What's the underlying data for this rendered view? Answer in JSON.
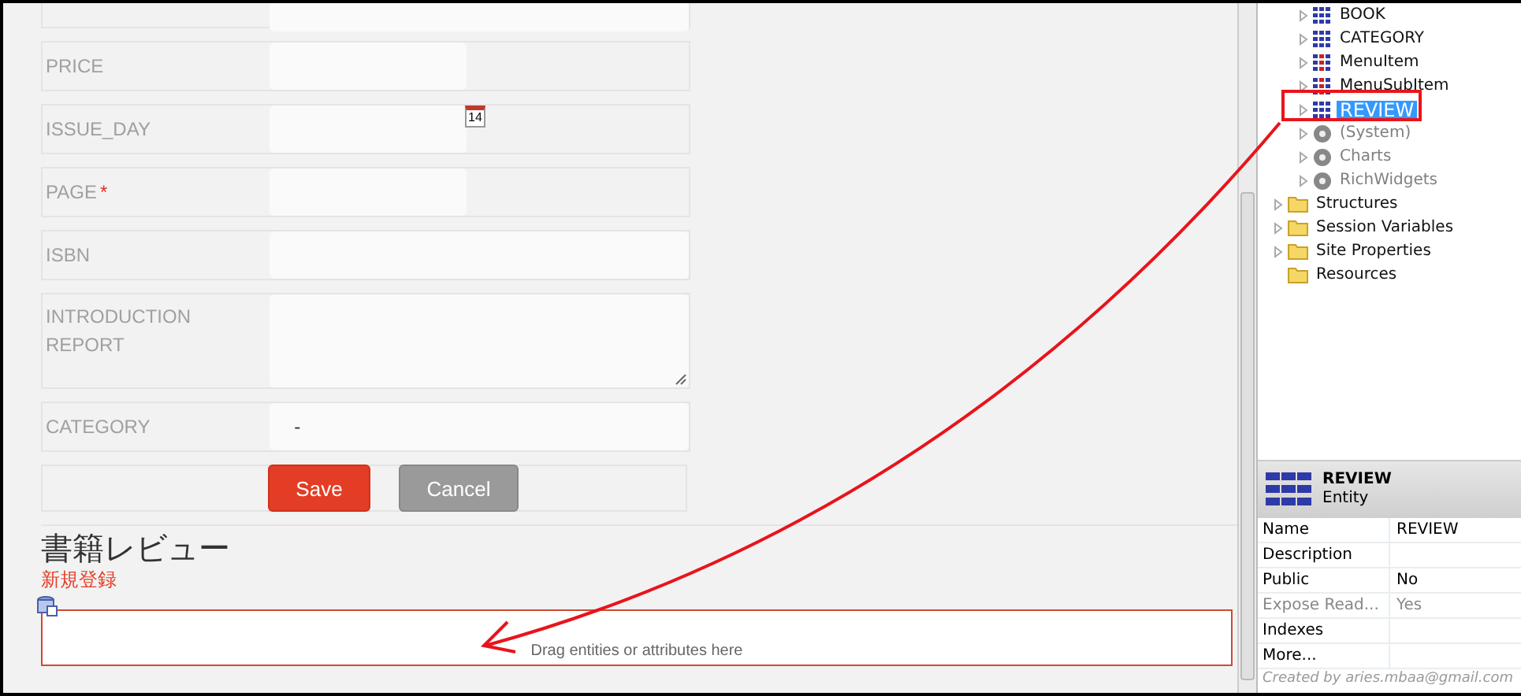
{
  "form": {
    "required_mark": "*",
    "rows": [
      {
        "label": "PRICE",
        "required": false,
        "kind": "short",
        "calendar": false
      },
      {
        "label": "ISSUE_DAY",
        "required": false,
        "kind": "short",
        "calendar": true,
        "calendar_day": "14"
      },
      {
        "label": "PAGE",
        "required": true,
        "kind": "short",
        "calendar": false
      },
      {
        "label": "ISBN",
        "required": false,
        "kind": "long",
        "calendar": false
      },
      {
        "label": "INTRODUCTION REPORT",
        "required": false,
        "kind": "textarea",
        "calendar": false
      },
      {
        "label": "CATEGORY",
        "required": false,
        "kind": "select",
        "value": "-",
        "calendar": false
      }
    ],
    "buttons": [
      {
        "label": "Save",
        "kind": "primary"
      },
      {
        "label": "Cancel",
        "kind": "secondary"
      }
    ]
  },
  "section": {
    "title": "書籍レビュー",
    "subtitle": "新規登録"
  },
  "drop_zone": {
    "text": "Drag entities or attributes here"
  },
  "tree": {
    "database_items": [
      {
        "label": "BOOK",
        "kind": "entity",
        "selected": false
      },
      {
        "label": "CATEGORY",
        "kind": "entity",
        "selected": false
      },
      {
        "label": "MenuItem",
        "kind": "static_entity",
        "selected": false
      },
      {
        "label": "MenuSubItem",
        "kind": "static_entity",
        "selected": false
      },
      {
        "label": "REVIEW",
        "kind": "entity",
        "selected": true
      },
      {
        "label": "(System)",
        "kind": "module",
        "selected": false
      },
      {
        "label": "Charts",
        "kind": "module",
        "selected": false
      },
      {
        "label": "RichWidgets",
        "kind": "module",
        "selected": false
      }
    ],
    "folders": [
      {
        "label": "Structures",
        "expandable": true
      },
      {
        "label": "Session Variables",
        "expandable": true
      },
      {
        "label": "Site Properties",
        "expandable": true
      },
      {
        "label": "Resources",
        "expandable": false
      }
    ]
  },
  "properties": {
    "title": "REVIEW",
    "subtitle": "Entity",
    "rows": [
      {
        "name": "Name",
        "value": "REVIEW",
        "disabled": false
      },
      {
        "name": "Description",
        "disabled": false
      },
      {
        "name": "Public",
        "value": "No",
        "disabled": false
      },
      {
        "name": "Expose Read...",
        "value": "Yes",
        "disabled": true
      },
      {
        "name": "Indexes",
        "disabled": false
      },
      {
        "name": "More...",
        "disabled": false
      }
    ],
    "footer": "Created by aries.mbaa@gmail.com"
  }
}
